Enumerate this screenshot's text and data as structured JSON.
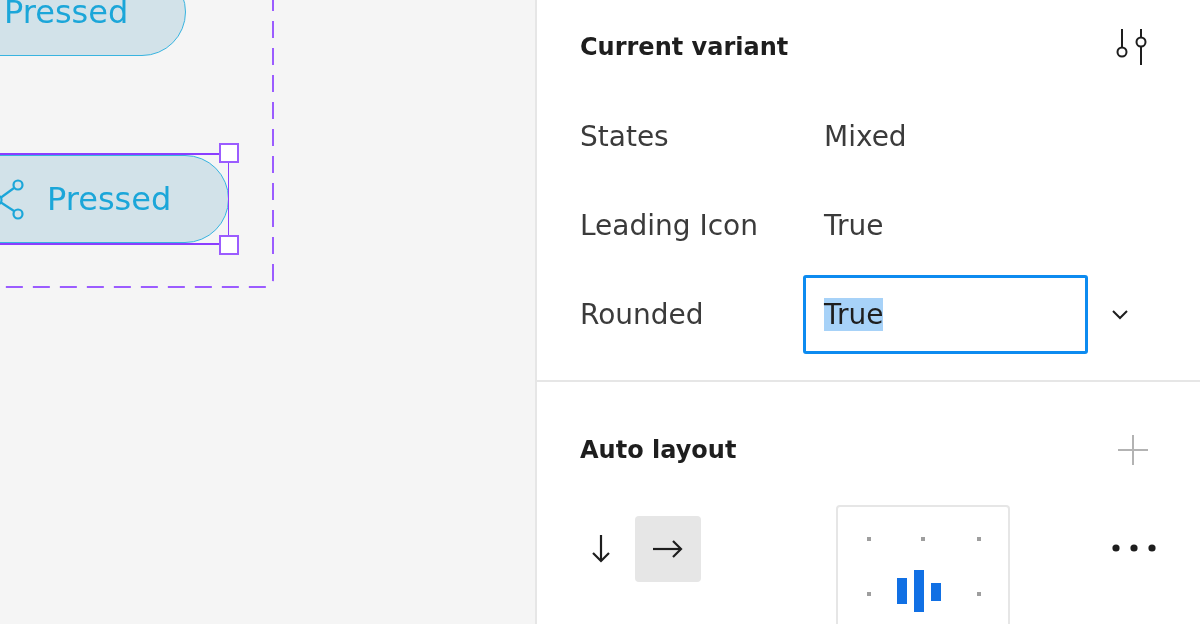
{
  "canvas": {
    "buttons": [
      {
        "label": "Pressed",
        "leading_icon": false,
        "selected": false
      },
      {
        "label": "Pressed",
        "leading_icon": true,
        "selected": true
      }
    ]
  },
  "current_variant": {
    "title": "Current variant",
    "properties": [
      {
        "kind": "text",
        "label": "States",
        "value": "Mixed"
      },
      {
        "kind": "text",
        "label": "Leading Icon",
        "value": "True"
      },
      {
        "kind": "dropdown",
        "label": "Rounded",
        "value": "True",
        "focused": true,
        "value_highlighted": true
      }
    ]
  },
  "auto_layout": {
    "title": "Auto layout",
    "directions": [
      {
        "kind": "vertical",
        "selected": false
      },
      {
        "kind": "horizontal",
        "selected": true
      }
    ]
  }
}
